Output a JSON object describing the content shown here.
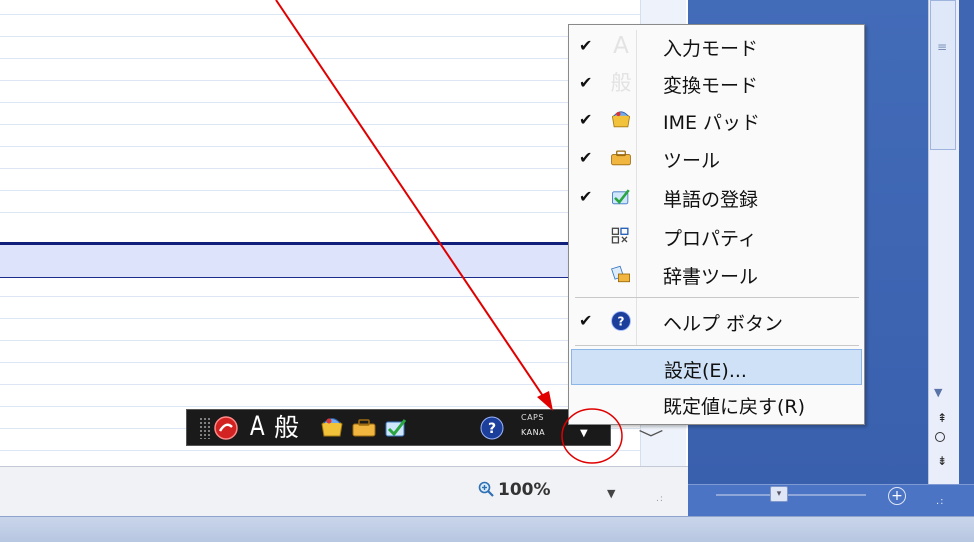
{
  "statusbar": {
    "zoom_label": "100%"
  },
  "ime_toolbar": {
    "input_mode_char": "A",
    "conversion_mode_char": "般",
    "caps_label": "CAPS",
    "kana_label": "KANA"
  },
  "menu": {
    "items": [
      {
        "label": "入力モード",
        "checked": true,
        "icon": "letter-a-icon",
        "icon_char": "A"
      },
      {
        "label": "変換モード",
        "checked": true,
        "icon": "han-character-icon",
        "icon_char": "般"
      },
      {
        "label": "IME パッド",
        "checked": true,
        "icon": "ime-pad-icon"
      },
      {
        "label": "ツール",
        "checked": true,
        "icon": "toolbox-icon"
      },
      {
        "label": "単語の登録",
        "checked": true,
        "icon": "word-register-icon"
      },
      {
        "label": "プロパティ",
        "checked": false,
        "icon": "properties-icon"
      },
      {
        "label": "辞書ツール",
        "checked": false,
        "icon": "dictionary-tool-icon"
      },
      {
        "label": "ヘルプ ボタン",
        "checked": true,
        "icon": "help-icon"
      },
      {
        "label": "設定(E)...",
        "checked": false,
        "highlighted": true
      },
      {
        "label": "既定値に戻す(R)",
        "checked": false
      }
    ]
  },
  "colors": {
    "annotation_red": "#e00000",
    "panel_blue": "#3f66b3",
    "menu_highlight": "#cfe1f7",
    "selection_fill": "#dde3fb"
  }
}
